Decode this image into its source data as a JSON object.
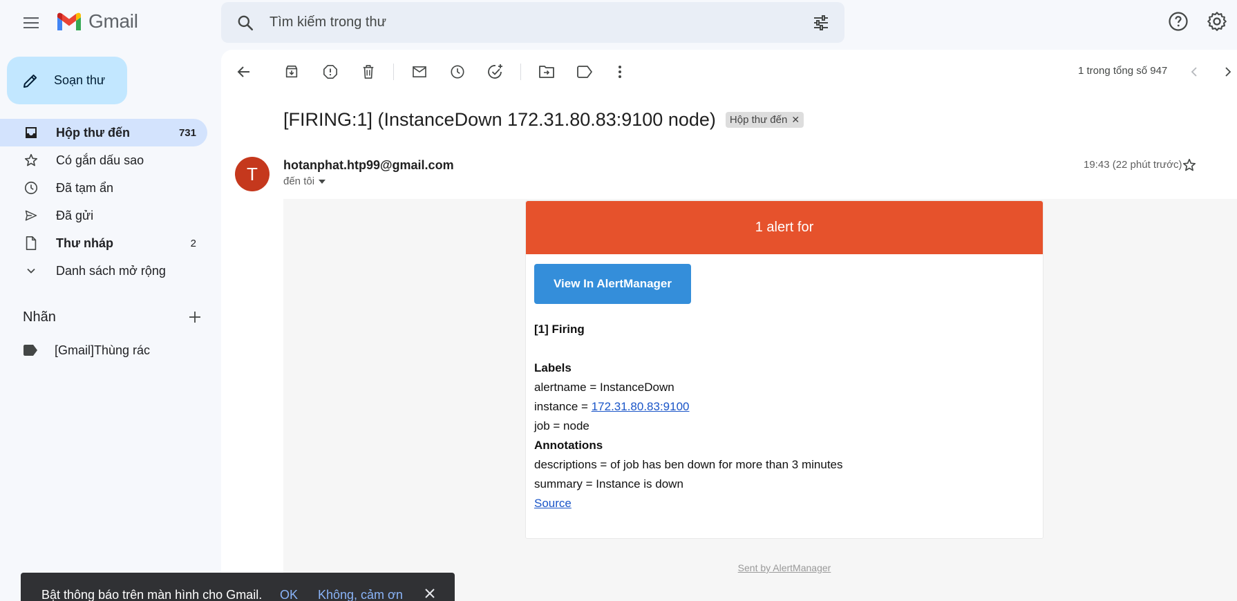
{
  "app": {
    "name": "Gmail"
  },
  "search": {
    "placeholder": "Tìm kiếm trong thư"
  },
  "compose": {
    "label": "Soạn thư"
  },
  "sidebar": {
    "items": [
      {
        "label": "Hộp thư đến",
        "count": "731",
        "icon": "inbox-icon"
      },
      {
        "label": "Có gắn dấu sao",
        "count": "",
        "icon": "star-icon"
      },
      {
        "label": "Đã tạm ẩn",
        "count": "",
        "icon": "clock-icon"
      },
      {
        "label": "Đã gửi",
        "count": "",
        "icon": "send-icon"
      },
      {
        "label": "Thư nháp",
        "count": "2",
        "icon": "draft-icon"
      },
      {
        "label": "Danh sách mở rộng",
        "count": "",
        "icon": "chevron-down-icon"
      }
    ],
    "labels_title": "Nhãn",
    "labels": [
      {
        "label": "[Gmail]Thùng rác",
        "icon": "label-icon"
      }
    ]
  },
  "toolbar": {
    "pager_text": "1 trong tổng số 947"
  },
  "email": {
    "subject": "[FIRING:1] (InstanceDown 172.31.80.83:9100 node)",
    "chip": "Hộp thư đến",
    "avatar_letter": "T",
    "sender": "hotanphat.htp99@gmail.com",
    "to": "đến tôi",
    "time": "19:43 (22 phút trước)",
    "card": {
      "header": "1 alert for",
      "button": "View In AlertManager",
      "firing": "[1] Firing",
      "labels_title": "Labels",
      "alertname": "alertname = InstanceDown",
      "instance_prefix": "instance = ",
      "instance_link": "172.31.80.83:9100",
      "job": "job = node",
      "annotations_title": "Annotations",
      "descriptions": "descriptions = of job has ben down for more than 3 minutes",
      "summary": "summary = Instance is down",
      "source": "Source"
    },
    "sent_by": "Sent by AlertManager"
  },
  "snackbar": {
    "message": "Bật thông báo trên màn hình cho Gmail.",
    "ok": "OK",
    "no": "Không, cảm ơn"
  },
  "colors": {
    "alert_header": "#e6522c",
    "button_blue": "#348eda",
    "compose_bg": "#c2e7ff",
    "active_nav": "#d3e3fd",
    "avatar": "#c5381d"
  }
}
